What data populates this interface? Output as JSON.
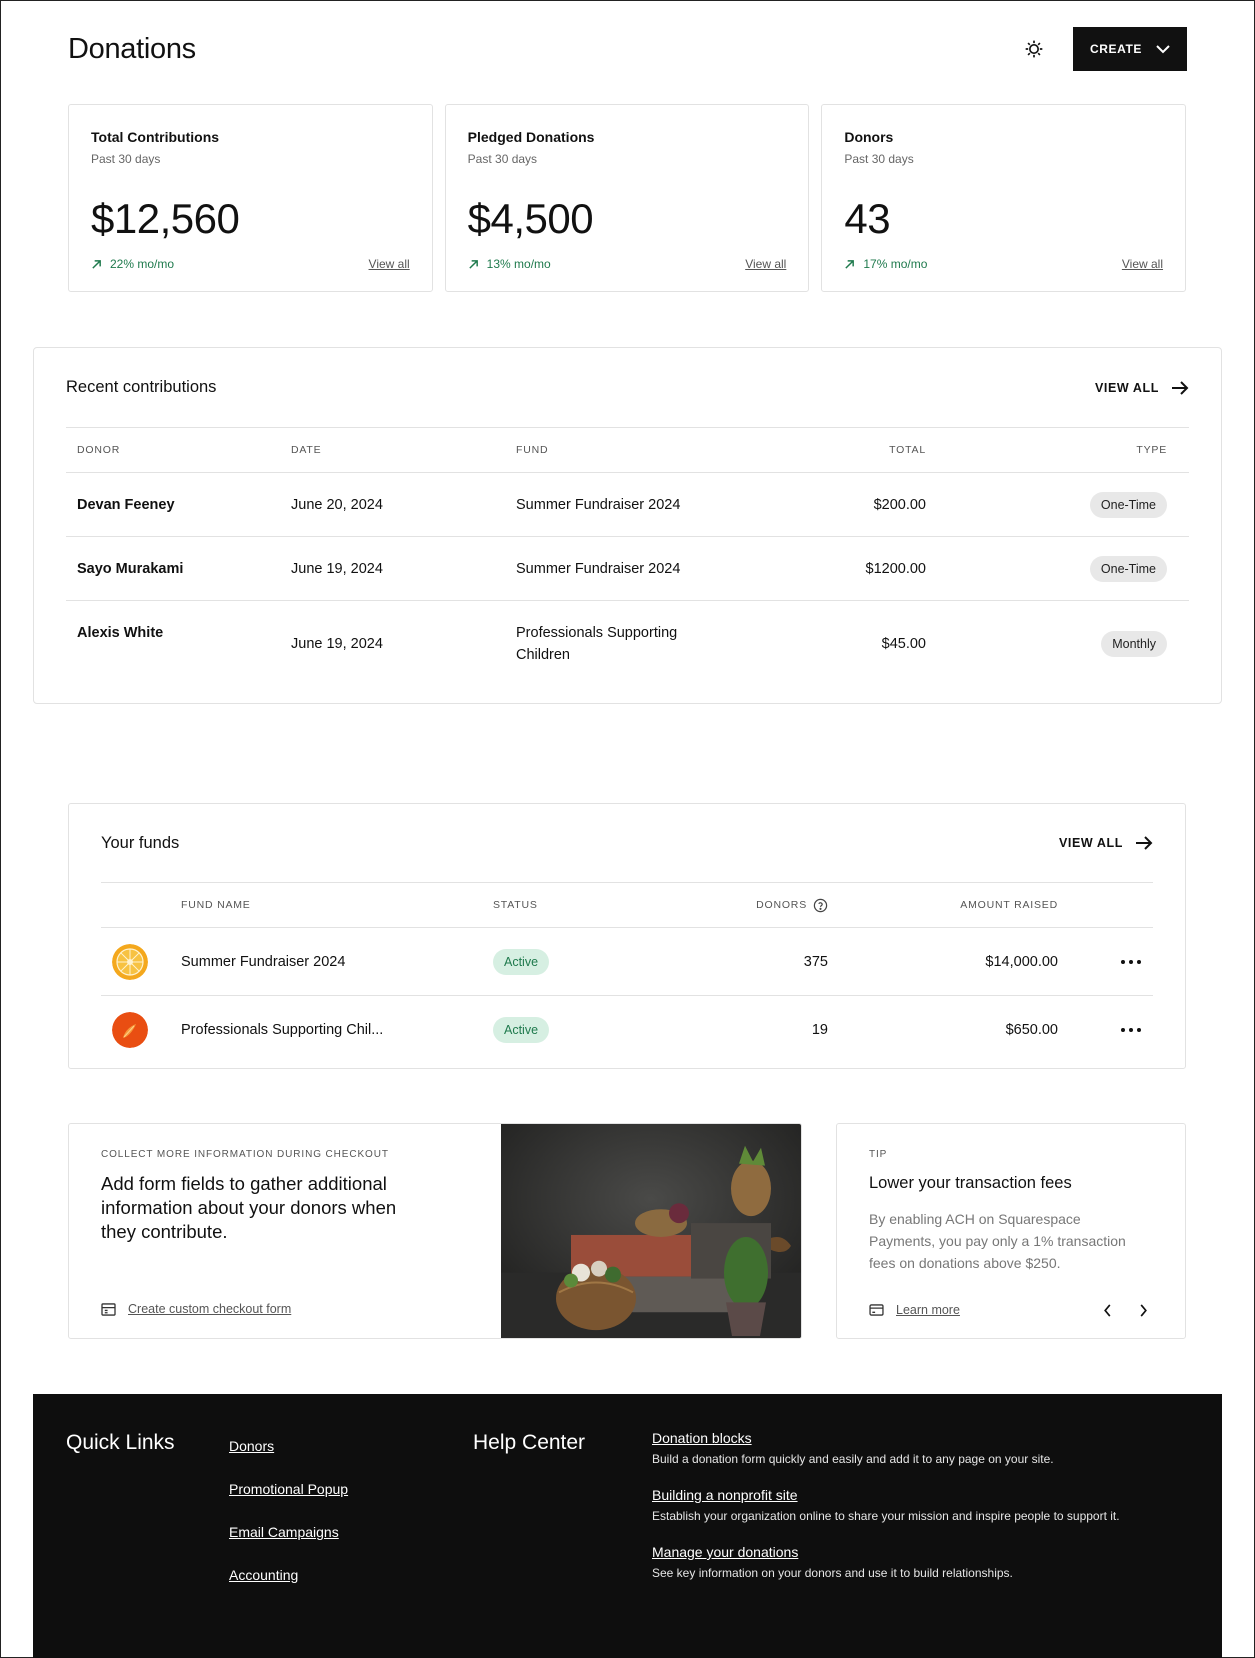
{
  "header": {
    "title": "Donations",
    "create_label": "CREATE"
  },
  "stats": [
    {
      "title": "Total Contributions",
      "period": "Past 30 days",
      "value": "$12,560",
      "change": "22% mo/mo",
      "link": "View all"
    },
    {
      "title": "Pledged Donations",
      "period": "Past 30 days",
      "value": "$4,500",
      "change": "13% mo/mo",
      "link": "View all"
    },
    {
      "title": "Donors",
      "period": "Past 30 days",
      "value": "43",
      "change": "17% mo/mo",
      "link": "View all"
    }
  ],
  "recent": {
    "title": "Recent contributions",
    "view_all": "VIEW ALL",
    "columns": {
      "donor": "DONOR",
      "date": "DATE",
      "fund": "FUND",
      "total": "TOTAL",
      "type": "TYPE"
    },
    "rows": [
      {
        "donor": "Devan Feeney",
        "date": "June 20, 2024",
        "fund": "Summer Fundraiser 2024",
        "total": "$200.00",
        "type": "One-Time"
      },
      {
        "donor": "Sayo Murakami",
        "date": "June 19, 2024",
        "fund": "Summer Fundraiser 2024",
        "total": "$1200.00",
        "type": "One-Time"
      },
      {
        "donor": "Alexis White",
        "date": "June 19, 2024",
        "fund": "Professionals Supporting Children",
        "total": "$45.00",
        "type": "Monthly"
      }
    ]
  },
  "funds": {
    "title": "Your funds",
    "view_all": "VIEW ALL",
    "columns": {
      "name": "FUND NAME",
      "status": "STATUS",
      "donors": "DONORS",
      "amount": "AMOUNT RAISED"
    },
    "rows": [
      {
        "name": "Summer Fundraiser 2024",
        "status": "Active",
        "donors": "375",
        "amount": "$14,000.00"
      },
      {
        "name": "Professionals Supporting Chil...",
        "status": "Active",
        "donors": "19",
        "amount": "$650.00"
      }
    ]
  },
  "promo": {
    "eyebrow": "COLLECT MORE INFORMATION DURING CHECKOUT",
    "heading": "Add form fields to gather additional information about your donors when they contribute.",
    "link": "Create custom checkout form"
  },
  "tip": {
    "eyebrow": "TIP",
    "title": "Lower your transaction fees",
    "body": "By enabling ACH on Squarespace Payments, you pay only a 1% transaction fees on donations above $250.",
    "link": "Learn more"
  },
  "footer": {
    "quick_links_title": "Quick Links",
    "quick_links": [
      "Donors",
      "Promotional Popup",
      "Email Campaigns",
      "Accounting"
    ],
    "help_title": "Help Center",
    "help_items": [
      {
        "title": "Donation blocks",
        "desc": "Build a donation form quickly and easily and add it to any page on your site."
      },
      {
        "title": "Building a nonprofit site",
        "desc": "Establish your organization online to share your mission and inspire people to support it."
      },
      {
        "title": "Manage your donations",
        "desc": "See key information on your donors and use it to build relationships."
      }
    ]
  },
  "colors": {
    "accent_green": "#1f7a4d",
    "active_bg": "#d6efe2",
    "footer_bg": "#0e0e0e",
    "button_bg": "#111111"
  },
  "icons": [
    "gear-icon",
    "chevron-down-icon",
    "arrow-up-right-icon",
    "arrow-right-icon",
    "help-circle-icon",
    "more-horizontal-icon",
    "form-icon",
    "card-icon",
    "chevron-left-icon",
    "chevron-right-icon"
  ]
}
